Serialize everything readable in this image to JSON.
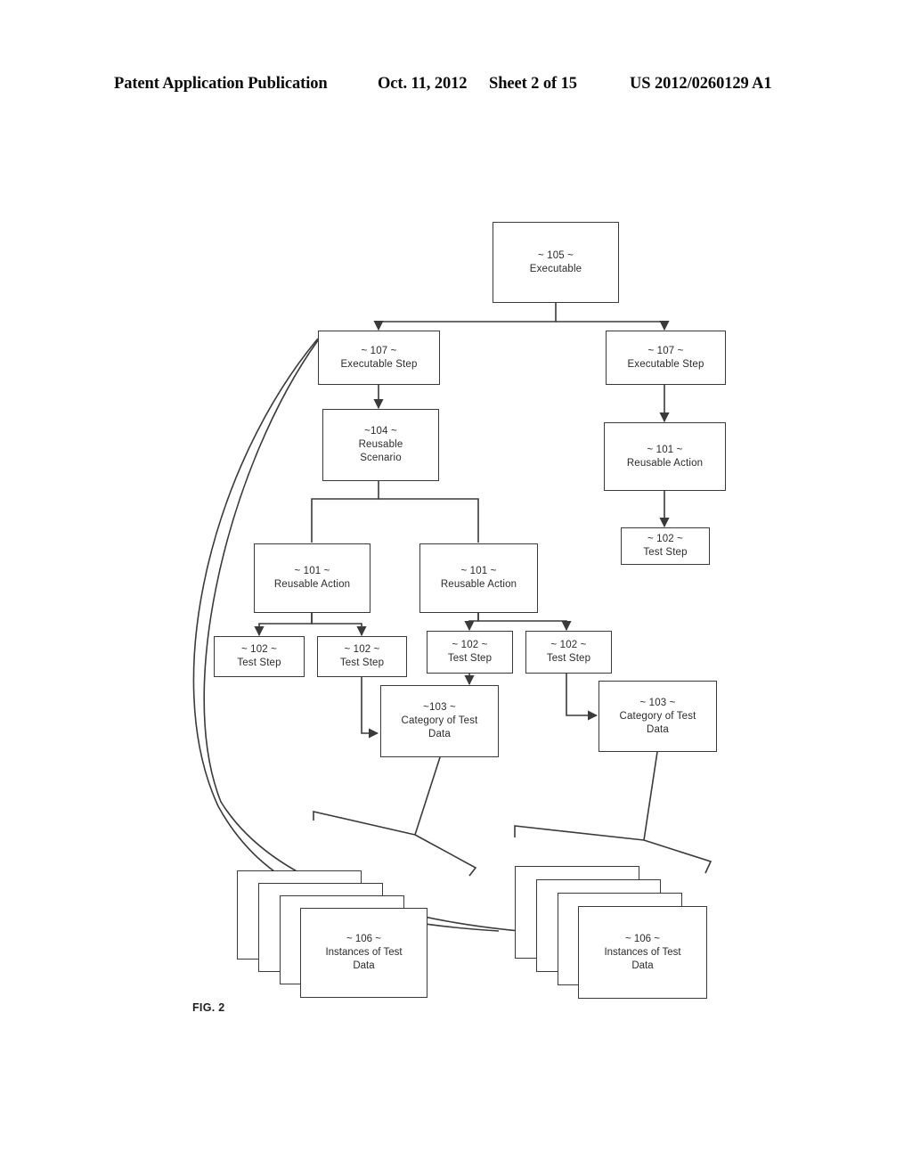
{
  "header": {
    "publication": "Patent Application Publication",
    "date": "Oct. 11, 2012",
    "sheet": "Sheet 2 of 15",
    "patent_number": "US 2012/0260129 A1"
  },
  "figure": {
    "caption": "FIG. 2",
    "line_color": "#3a3a3a"
  },
  "nodes": {
    "executable": {
      "ref": "~ 105 ~",
      "label": "Executable"
    },
    "exec_step_left": {
      "ref": "~ 107 ~",
      "label": "Executable Step"
    },
    "exec_step_right": {
      "ref": "~ 107 ~",
      "label": "Executable Step"
    },
    "reusable_scenario": {
      "ref": "~104 ~",
      "label_line1": "Reusable",
      "label_line2": "Scenario"
    },
    "reusable_action_right": {
      "ref": "~ 101 ~",
      "label": "Reusable Action"
    },
    "test_step_right": {
      "ref": "~ 102 ~",
      "label": "Test Step"
    },
    "reusable_action_mid_left": {
      "ref": "~ 101 ~",
      "label": "Reusable Action"
    },
    "reusable_action_mid_right": {
      "ref": "~ 101 ~",
      "label": "Reusable Action"
    },
    "test_step_1": {
      "ref": "~ 102 ~",
      "label": "Test Step"
    },
    "test_step_2": {
      "ref": "~ 102 ~",
      "label": "Test Step"
    },
    "test_step_3": {
      "ref": "~ 102 ~",
      "label": "Test Step"
    },
    "test_step_4": {
      "ref": "~ 102 ~",
      "label": "Test Step"
    },
    "category_left": {
      "ref": "~103 ~",
      "label_line1": "Category of Test",
      "label_line2": "Data"
    },
    "category_right": {
      "ref": "~ 103 ~",
      "label_line1": "Category of Test",
      "label_line2": "Data"
    },
    "instances_left": {
      "ref": "~ 106 ~",
      "label_line1": "Instances of Test",
      "label_line2": "Data",
      "card_count": 4
    },
    "instances_right": {
      "ref": "~ 106 ~",
      "label_line1": "Instances of Test",
      "label_line2": "Data",
      "card_count": 4
    }
  }
}
